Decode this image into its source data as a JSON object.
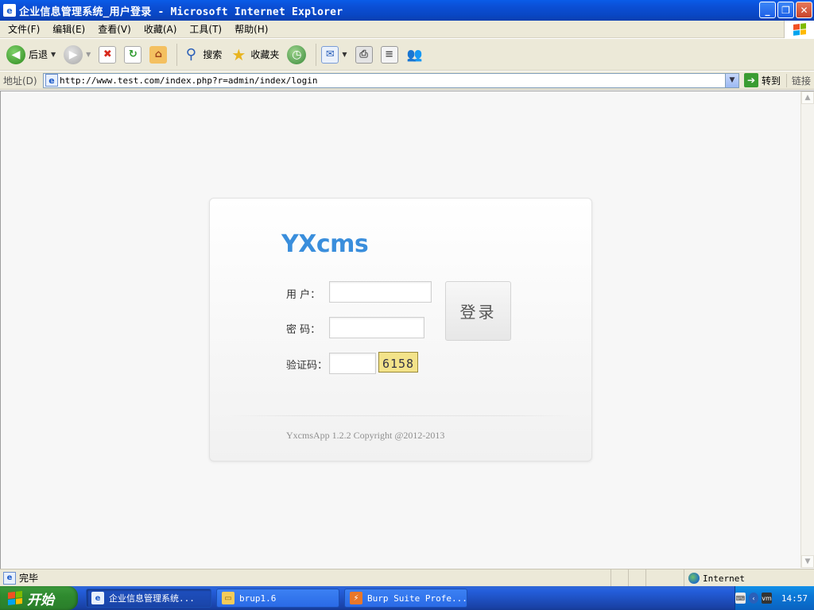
{
  "window": {
    "title": "企业信息管理系统_用户登录 - Microsoft Internet Explorer",
    "controls": {
      "minimize": "_",
      "maximize": "❐",
      "close": "✕"
    }
  },
  "menu": [
    "文件(F)",
    "编辑(E)",
    "查看(V)",
    "收藏(A)",
    "工具(T)",
    "帮助(H)"
  ],
  "toolbar": {
    "back_label": "后退",
    "search_label": "搜索",
    "favorites_label": "收藏夹"
  },
  "address": {
    "label": "地址(D)",
    "url": "http://www.test.com/index.php?r=admin/index/login",
    "go_label": "转到",
    "links_label": "链接"
  },
  "login": {
    "brand": "YXcms",
    "username_label": "用  户：",
    "password_label": "密  码：",
    "captcha_label": "验证码：",
    "captcha_text": "6158",
    "submit_label": "登录",
    "copyright": "YxcmsApp 1.2.2 Copyright @2012-2013"
  },
  "status": {
    "text": "完毕",
    "zone": "Internet"
  },
  "taskbar": {
    "start_label": "开始",
    "items": [
      {
        "label": "企业信息管理系统..."
      },
      {
        "label": "brup1.6"
      },
      {
        "label": "Burp Suite Profe..."
      }
    ],
    "tray": {
      "clock": "14:57"
    }
  },
  "colors": {
    "brand": "#3a8edc",
    "titlebar": "#0b4fd6",
    "taskbar": "#245edb",
    "start": "#2f8a2f"
  }
}
